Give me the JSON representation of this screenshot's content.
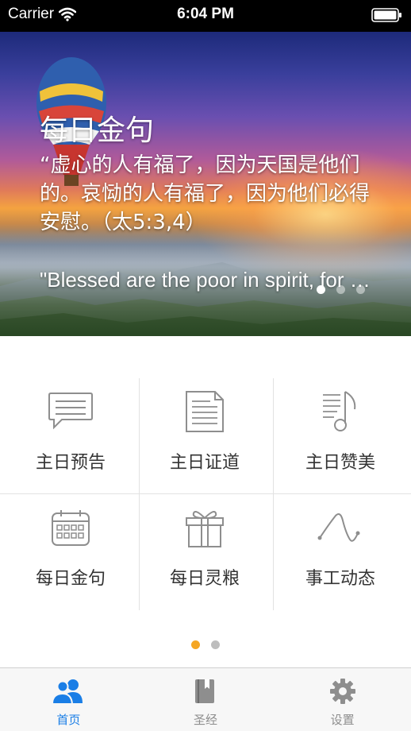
{
  "status_bar": {
    "carrier": "Carrier",
    "time": "6:04 PM"
  },
  "hero": {
    "title": "每日金句",
    "verse_cn": "“虚心的人有福了，因为天国是他们的。哀恸的人有福了，因为他们必得安慰。（太5:3,4）",
    "verse_en": "\"Blessed are the poor in spirit, for theirs is the kingdom of heaven.\"",
    "pages": 3,
    "active_page": 1
  },
  "grid": {
    "items": [
      {
        "label": "主日预告",
        "icon": "chat-bubble-icon"
      },
      {
        "label": "主日证道",
        "icon": "document-icon"
      },
      {
        "label": "主日赞美",
        "icon": "music-note-icon"
      },
      {
        "label": "每日金句",
        "icon": "calendar-icon"
      },
      {
        "label": "每日灵粮",
        "icon": "gift-icon"
      },
      {
        "label": "事工动态",
        "icon": "wave-curve-icon"
      }
    ],
    "pages": 2,
    "active_page": 1
  },
  "tab_bar": {
    "tabs": [
      {
        "label": "首页",
        "icon": "users-icon",
        "active": true
      },
      {
        "label": "圣经",
        "icon": "book-icon",
        "active": false
      },
      {
        "label": "设置",
        "icon": "gear-icon",
        "active": false
      }
    ]
  },
  "colors": {
    "accent": "#1a7ee6",
    "page_dot_active": "#f5a623",
    "icon_gray": "#8e8e8e"
  }
}
